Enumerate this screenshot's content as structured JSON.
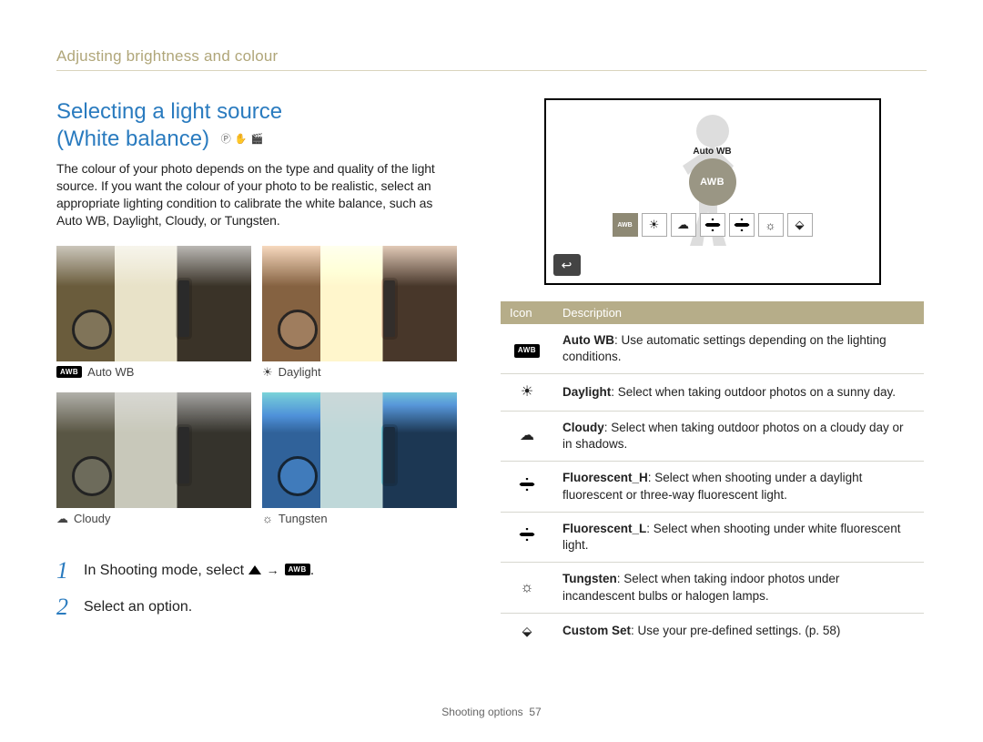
{
  "section_header": "Adjusting brightness and colour",
  "title_line1": "Selecting a light source",
  "title_line2": "(White balance)",
  "intro": "The colour of your photo depends on the type and quality of the light source. If you want the colour of your photo to be realistic, select an appropriate lighting condition to calibrate the white balance, such as Auto WB, Daylight, Cloudy, or Tungsten.",
  "thumbs": {
    "awb": "Auto WB",
    "daylight": "Daylight",
    "cloudy": "Cloudy",
    "tungsten": "Tungsten"
  },
  "steps": {
    "s1_a": "In Shooting mode, select",
    "s1_arrow": "→",
    "s1_end": ".",
    "s2": "Select an option."
  },
  "screen": {
    "big_label": "Auto WB",
    "big_text": "AWB",
    "row_awb": "AWB"
  },
  "table": {
    "head_icon": "Icon",
    "head_desc": "Description",
    "rows": [
      {
        "icon": "awb",
        "name": "Auto WB",
        "desc": ": Use automatic settings depending on the lighting conditions."
      },
      {
        "icon": "sun",
        "name": "Daylight",
        "desc": ": Select when taking outdoor photos on a sunny day."
      },
      {
        "icon": "cloud",
        "name": "Cloudy",
        "desc": ": Select when taking outdoor photos on a cloudy day or in shadows."
      },
      {
        "icon": "fluor",
        "name": "Fluorescent_H",
        "desc": ": Select when shooting under a daylight fluorescent or three-way fluorescent light."
      },
      {
        "icon": "fluor",
        "name": "Fluorescent_L",
        "desc": ": Select when shooting under white fluorescent light."
      },
      {
        "icon": "bulb",
        "name": "Tungsten",
        "desc": ": Select when taking indoor photos under incandescent bulbs or halogen lamps."
      },
      {
        "icon": "custom",
        "name": "Custom Set",
        "desc": ": Use your pre-defined settings. (p. 58)"
      }
    ]
  },
  "footer": {
    "section": "Shooting options",
    "page": "57"
  }
}
